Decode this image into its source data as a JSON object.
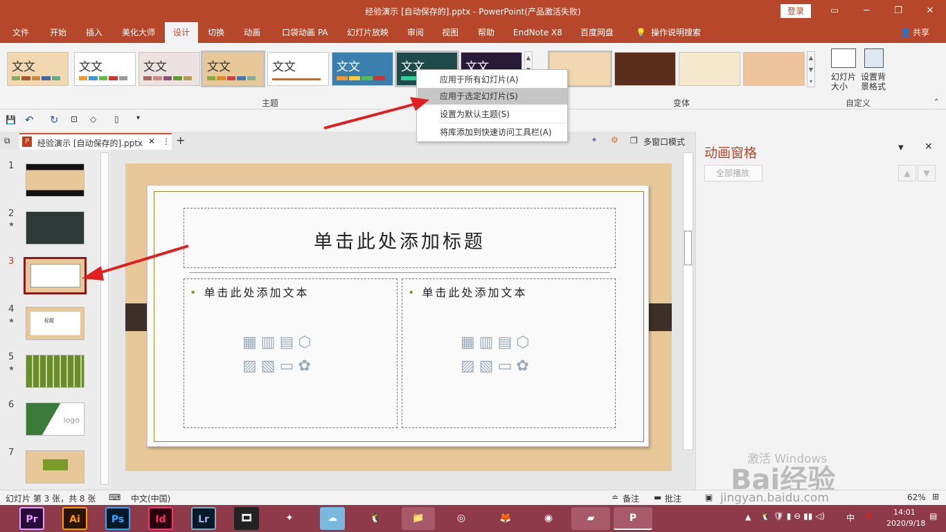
{
  "window": {
    "title": "经验演示 [自动保存的].pptx  -  PowerPoint(产品激活失败)",
    "login": "登录",
    "colors": {
      "accent": "#b7472a",
      "taskbar": "#8e3a4b"
    }
  },
  "menu": [
    "文件",
    "开始",
    "插入",
    "美化大师",
    "设计",
    "切换",
    "动画",
    "口袋动画 PA",
    "幻灯片放映",
    "审阅",
    "视图",
    "帮助",
    "EndNote X8",
    "百度网盘",
    "操作说明搜索",
    "共享"
  ],
  "ribbon": {
    "theme_text": "文文",
    "theme_group": "主题",
    "variant_group": "变体",
    "custom_group": "自定义",
    "slide_size": "幻灯片\n大小",
    "bg_format": "设置背\n景格式"
  },
  "context_menu": [
    "应用于所有幻灯片(A)",
    "应用于选定幻灯片(S)",
    "设置为默认主题(S)",
    "将库添加到快速访问工具栏(A)"
  ],
  "doc_tab": {
    "name": "经验演示 [自动保存的].pptx",
    "multiwindow": "多窗口模式"
  },
  "slides": {
    "numbers": [
      "1",
      "2",
      "3",
      "4",
      "5",
      "6",
      "7"
    ],
    "thumb4_text": "标题",
    "thumb6_text": "logo"
  },
  "slide": {
    "title": "单击此处添加标题",
    "body_left": "单击此处添加文本",
    "body_right": "单击此处添加文本"
  },
  "anim_pane": {
    "title": "动画窗格",
    "play_all": "全部播放"
  },
  "status": {
    "slide_info": "幻灯片 第 3 张，共 8 张",
    "language": "中文(中国)",
    "notes": "备注",
    "comments": "批注",
    "zoom": "62%"
  },
  "taskbar": {
    "apps": [
      "Pr",
      "Ai",
      "Ps",
      "Id",
      "Lr"
    ],
    "time": "14:01",
    "date": "2020/9/18",
    "ime": "中"
  },
  "watermark": {
    "activate": "激活 Windows",
    "baidu": "Bai经验",
    "url": "jingyan.baidu.com"
  }
}
